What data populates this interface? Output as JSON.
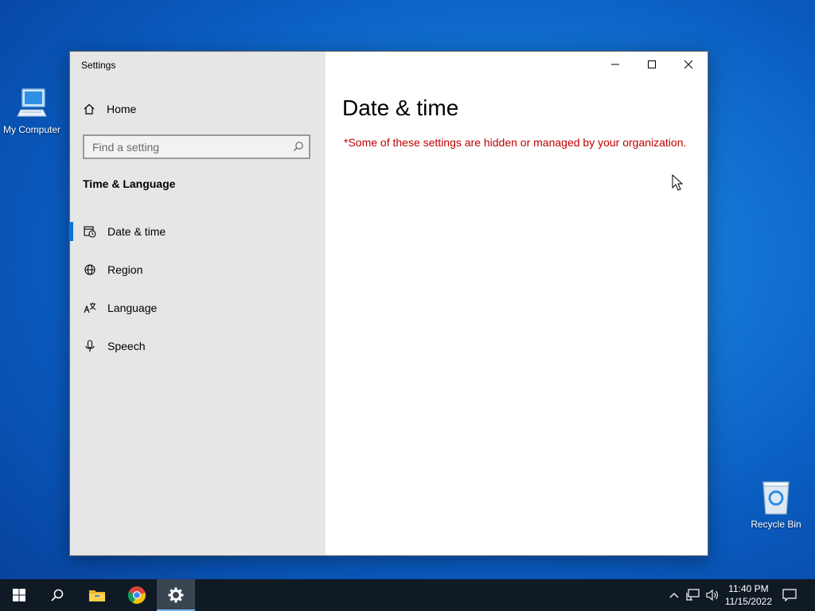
{
  "desktop": {
    "icons": [
      {
        "label": "My Computer"
      },
      {
        "label": "Recycle Bin"
      }
    ]
  },
  "window": {
    "title": "Settings",
    "controls": {
      "minimize": "minimize-icon",
      "maximize": "maximize-icon",
      "close": "close-icon"
    }
  },
  "sidebar": {
    "home_label": "Home",
    "search_placeholder": "Find a setting",
    "section_title": "Time & Language",
    "items": [
      {
        "label": "Date & time",
        "icon": "date-time-icon",
        "active": true
      },
      {
        "label": "Region",
        "icon": "globe-icon",
        "active": false
      },
      {
        "label": "Language",
        "icon": "language-icon",
        "active": false
      },
      {
        "label": "Speech",
        "icon": "microphone-icon",
        "active": false
      }
    ]
  },
  "main": {
    "title": "Date & time",
    "warning": "*Some of these settings are hidden or managed by your organization."
  },
  "taskbar": {
    "apps": [
      "start-icon",
      "search-icon",
      "file-explorer-icon",
      "chrome-icon",
      "settings-icon"
    ],
    "clock": {
      "time": "11:40 PM",
      "date": "11/15/2022"
    }
  },
  "colors": {
    "accent": "#0078d7",
    "warning": "#c00000",
    "taskbar": "#101a25"
  }
}
